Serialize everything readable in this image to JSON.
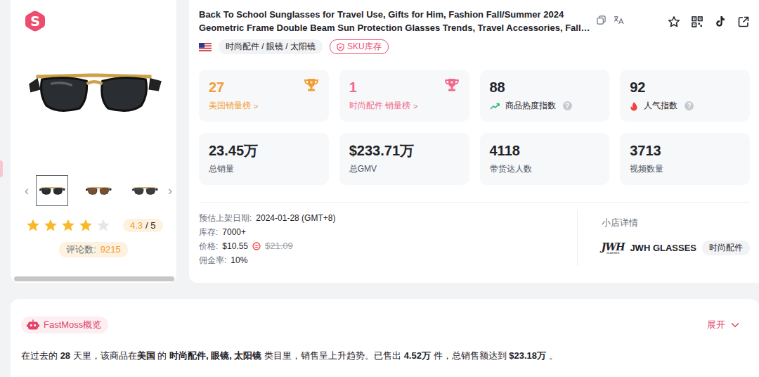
{
  "logo": {
    "letter": "S"
  },
  "product": {
    "prev": "‹",
    "next": "›",
    "thumbnails": [
      {
        "selected": true
      },
      {
        "selected": false
      },
      {
        "selected": false
      }
    ],
    "rating": {
      "stars": 4,
      "value": "4.3",
      "max": "/ 5"
    },
    "reviews": {
      "label": "评论数:",
      "count": "9215"
    }
  },
  "title": {
    "lines": [
      "Back To School Sunglasses for Travel Use, Gifts for Him, Fashion Fall/Summer 2024",
      "Geometric Frame Double Beam Sun Protection Glasses Trends, Travel Accessories, Fall…"
    ]
  },
  "category": "时尚配件 / 眼镜 / 太阳镜",
  "sku_button": "SKU库存",
  "stats": [
    {
      "kind": "rank",
      "value": "27",
      "label": "美国销量榜",
      "arrow": ">",
      "color": "#f39c32"
    },
    {
      "kind": "rank",
      "value": "1",
      "label": "时尚配件 销量榜",
      "arrow": ">",
      "color": "#f0688a"
    },
    {
      "kind": "heat",
      "value": "88",
      "label": "商品热度指数",
      "help": "?",
      "color": "#1f2329"
    },
    {
      "kind": "popularity",
      "value": "92",
      "label": "人气指数",
      "help": "?",
      "color": "#1f2329"
    },
    {
      "kind": "total",
      "value": "23.45万",
      "label": "总销量",
      "color": "#1f2329"
    },
    {
      "kind": "total",
      "value": "$233.71万",
      "label": "总GMV",
      "color": "#1f2329"
    },
    {
      "kind": "total",
      "value": "4118",
      "label": "带货达人数",
      "color": "#1f2329"
    },
    {
      "kind": "total",
      "value": "3713",
      "label": "视频数量",
      "color": "#1f2329"
    }
  ],
  "info": [
    {
      "kind": "plain",
      "label": "预估上架日期:",
      "value": "2024-01-28 (GMT+8)"
    },
    {
      "kind": "plain",
      "label": "库存:",
      "value": "7000+"
    },
    {
      "kind": "price",
      "label": "价格:",
      "value": "$10.55",
      "original": "$21.09"
    },
    {
      "kind": "plain",
      "label": "佣金率:",
      "value": "10%"
    }
  ],
  "shop": {
    "heading": "小店详情",
    "logo": "JWH",
    "logo_sub": "GLASSES",
    "name": "JWH GLASSES",
    "tag": "时尚配件"
  },
  "overview": {
    "title": "FastMoss概览",
    "expand": "展开",
    "segments": [
      {
        "text": "在过去的 ",
        "bold": false
      },
      {
        "text": "28",
        "bold": true
      },
      {
        "text": " 天里，该商品在",
        "bold": false
      },
      {
        "text": "美国",
        "bold": true
      },
      {
        "text": " 的 ",
        "bold": false
      },
      {
        "text": "时尚配件, 眼镜, 太阳镜",
        "bold": true
      },
      {
        "text": " 类目里，销售呈上升趋势。已售出 ",
        "bold": false
      },
      {
        "text": "4.52万",
        "bold": true
      },
      {
        "text": " 件，总销售额达到 ",
        "bold": false
      },
      {
        "text": "$23.18万",
        "bold": true
      },
      {
        "text": " 。",
        "bold": false
      }
    ]
  }
}
